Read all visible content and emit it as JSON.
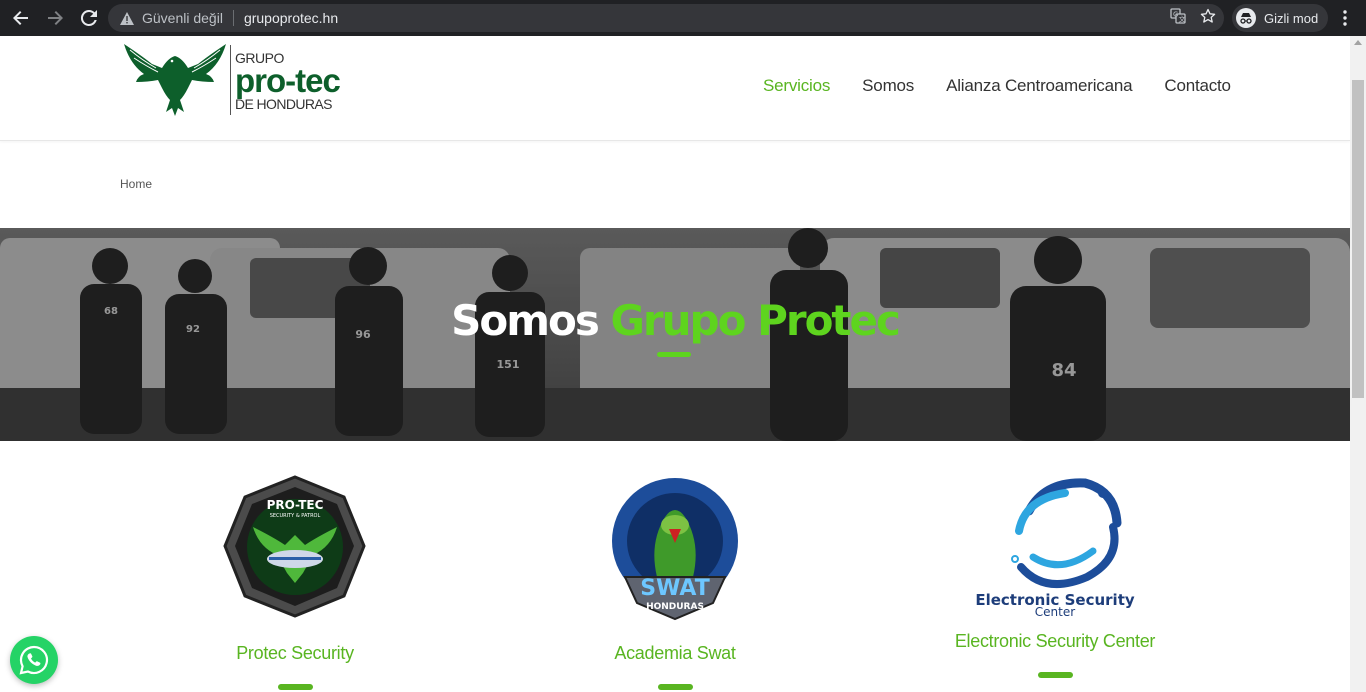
{
  "browser": {
    "security_label": "Güvenli değil",
    "url": "grupoprotec.hn",
    "profile_label": "Gizli mod"
  },
  "logo": {
    "line1": "GRUPO",
    "line2": "pro-tec",
    "line3": "DE HONDURAS"
  },
  "nav": {
    "items": [
      {
        "label": "Servicios",
        "active": true
      },
      {
        "label": "Somos",
        "active": false
      },
      {
        "label": "Alianza Centroamericana",
        "active": false
      },
      {
        "label": "Contacto",
        "active": false
      }
    ]
  },
  "breadcrumb": {
    "home": "Home"
  },
  "hero": {
    "title_white": "Somos",
    "title_green": "Grupo Protec",
    "vest_numbers": [
      "68",
      "92",
      "96",
      "151",
      "84"
    ]
  },
  "services": [
    {
      "title": "Protec Security",
      "badge_text": "PRO-TEC",
      "badge_sub": "SECURITY & PATROL"
    },
    {
      "title": "Academia Swat",
      "badge_text": "SWAT",
      "badge_sub": "HONDURAS"
    },
    {
      "title": "Electronic Security Center",
      "badge_text": "Electronic Security",
      "badge_sub": "Center"
    }
  ],
  "colors": {
    "accent_green": "#59b521",
    "hero_green": "#5ed41e",
    "logo_green": "#0d5f2b",
    "chrome_bg": "#202124",
    "whatsapp": "#25d366"
  }
}
